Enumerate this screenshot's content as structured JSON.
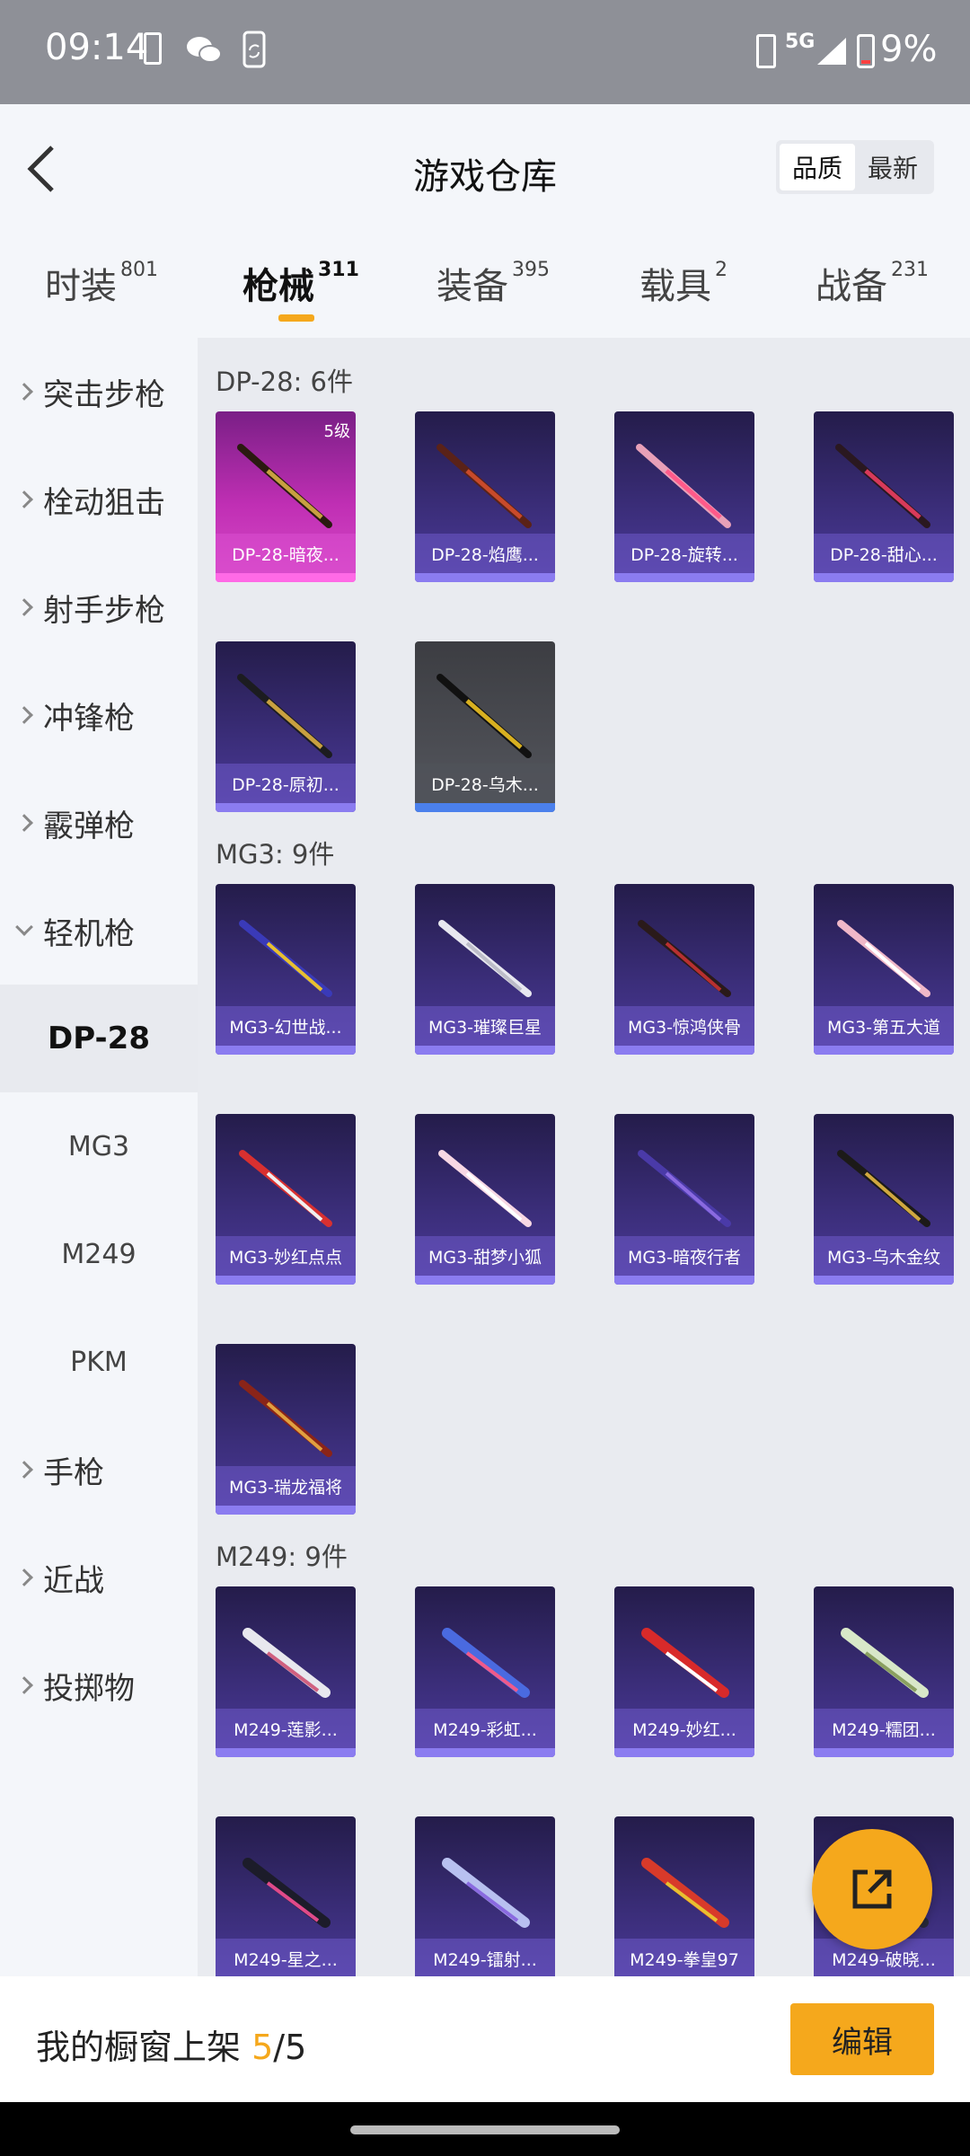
{
  "status_bar": {
    "time": "09:14",
    "network": "5G",
    "battery": "9%"
  },
  "header": {
    "title": "游戏仓库",
    "sort_options": [
      "品质",
      "最新"
    ]
  },
  "tabs": [
    {
      "label": "时装",
      "count": "801"
    },
    {
      "label": "枪械",
      "count": "311"
    },
    {
      "label": "装备",
      "count": "395"
    },
    {
      "label": "载具",
      "count": "2"
    },
    {
      "label": "战备",
      "count": "231"
    }
  ],
  "sidebar": {
    "categories": [
      "突击步枪",
      "栓动狙击",
      "射手步枪",
      "冲锋枪",
      "霰弹枪",
      "轻机枪",
      "手枪",
      "近战",
      "投掷物"
    ],
    "subitems": [
      "DP-28",
      "MG3",
      "M249",
      "PKM"
    ]
  },
  "sections": [
    {
      "title": "DP-28: 6件",
      "items": [
        "DP-28-暗夜...",
        "DP-28-焰鹰...",
        "DP-28-旋转...",
        "DP-28-甜心...",
        "DP-28-原初...",
        "DP-28-乌木..."
      ]
    },
    {
      "title": "MG3: 9件",
      "items": [
        "MG3-幻世战...",
        "MG3-璀璨巨星",
        "MG3-惊鸿侠骨",
        "MG3-第五大道",
        "MG3-妙红点点",
        "MG3-甜梦小狐",
        "MG3-暗夜行者",
        "MG3-乌木金纹",
        "MG3-瑞龙福将"
      ]
    },
    {
      "title": "M249: 9件",
      "items": [
        "M249-莲影...",
        "M249-彩虹...",
        "M249-妙红...",
        "M249-糯团...",
        "M249-星之...",
        "M249-镭射...",
        "M249-拳皇97",
        "M249-破晓..."
      ]
    }
  ],
  "first_card_level": "5级",
  "bottom": {
    "showcase_label": "我的橱窗上架 ",
    "current": "5",
    "total": "/5",
    "edit_label": "编辑"
  },
  "colors": {
    "accent": "#f5a81c",
    "card_purple": "#3a2d78",
    "card_pink": "#c02fb4",
    "card_gray": "#55575e"
  }
}
